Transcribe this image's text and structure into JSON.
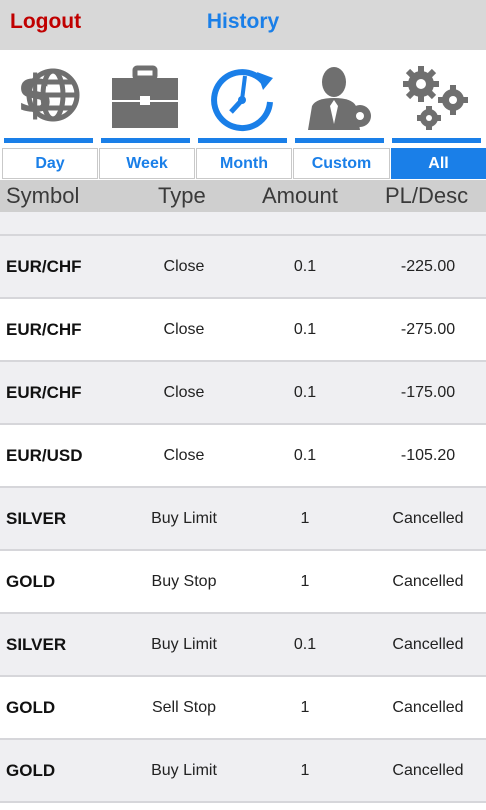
{
  "header": {
    "logout_label": "Logout",
    "title": "History"
  },
  "nav_icons": [
    "currency-globe-icon",
    "briefcase-icon",
    "clock-refresh-icon",
    "user-settings-icon",
    "gears-icon"
  ],
  "tabs": [
    {
      "label": "Day",
      "active": false
    },
    {
      "label": "Week",
      "active": false
    },
    {
      "label": "Month",
      "active": false
    },
    {
      "label": "Custom",
      "active": false
    },
    {
      "label": "All",
      "active": true
    }
  ],
  "columns": {
    "symbol": "Symbol",
    "type": "Type",
    "amount": "Amount",
    "pl": "PL/Desc"
  },
  "rows": [
    {
      "symbol": "EUR/CHF",
      "type": "Close",
      "amount": "0.1",
      "pl": "-225.00"
    },
    {
      "symbol": "EUR/CHF",
      "type": "Close",
      "amount": "0.1",
      "pl": "-275.00"
    },
    {
      "symbol": "EUR/CHF",
      "type": "Close",
      "amount": "0.1",
      "pl": "-175.00"
    },
    {
      "symbol": "EUR/USD",
      "type": "Close",
      "amount": "0.1",
      "pl": "-105.20"
    },
    {
      "symbol": "SILVER",
      "type": "Buy Limit",
      "amount": "1",
      "pl": "Cancelled"
    },
    {
      "symbol": "GOLD",
      "type": "Buy Stop",
      "amount": "1",
      "pl": "Cancelled"
    },
    {
      "symbol": "SILVER",
      "type": "Buy Limit",
      "amount": "0.1",
      "pl": "Cancelled"
    },
    {
      "symbol": "GOLD",
      "type": "Sell Stop",
      "amount": "1",
      "pl": "Cancelled"
    },
    {
      "symbol": "GOLD",
      "type": "Buy Limit",
      "amount": "1",
      "pl": "Cancelled"
    }
  ],
  "colors": {
    "accent": "#1a7fe8",
    "logout": "#c00000",
    "icon_gray": "#6f6f6f"
  }
}
